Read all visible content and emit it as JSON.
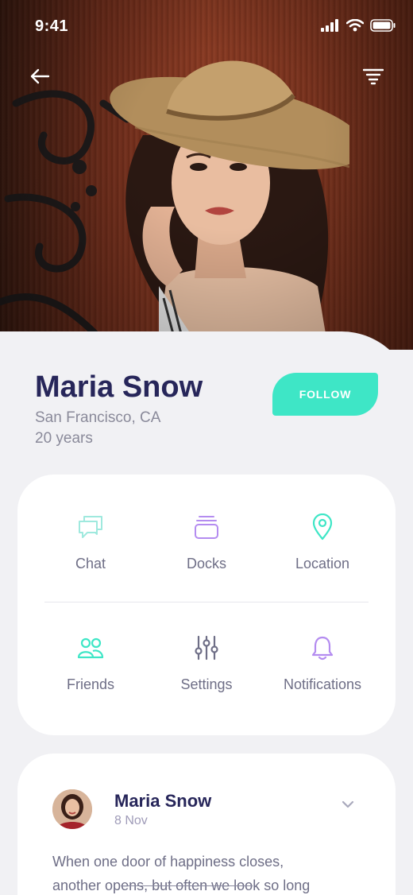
{
  "status_bar": {
    "time": "9:41"
  },
  "nav": {
    "back_icon": "arrow-left-icon",
    "filter_icon": "filter-icon"
  },
  "profile": {
    "name": "Maria Snow",
    "location": "San Francisco, CA",
    "age": "20 years",
    "follow_label": "FOLLOW"
  },
  "menu": {
    "items": [
      {
        "label": "Chat",
        "icon": "chat-icon",
        "color": "#9fe9de"
      },
      {
        "label": "Docks",
        "icon": "docks-icon",
        "color": "#b48cf0"
      },
      {
        "label": "Location",
        "icon": "location-pin-icon",
        "color": "#3ee6c6"
      },
      {
        "label": "Friends",
        "icon": "friends-icon",
        "color": "#3ee6c6"
      },
      {
        "label": "Settings",
        "icon": "settings-sliders-icon",
        "color": "#6e6e86"
      },
      {
        "label": "Notifications",
        "icon": "bell-icon",
        "color": "#b48cf0"
      }
    ]
  },
  "post": {
    "author": "Maria Snow",
    "date": "8 Nov",
    "text_line1": "When one door of happiness closes,",
    "text_line2_a": "another op",
    "text_line2_b": "ens, but often we loo",
    "text_line2_c": "k so long"
  },
  "colors": {
    "accent": "#3ee6c6",
    "heading": "#27265a",
    "muted": "#8a8a9a",
    "purple": "#b48cf0"
  }
}
